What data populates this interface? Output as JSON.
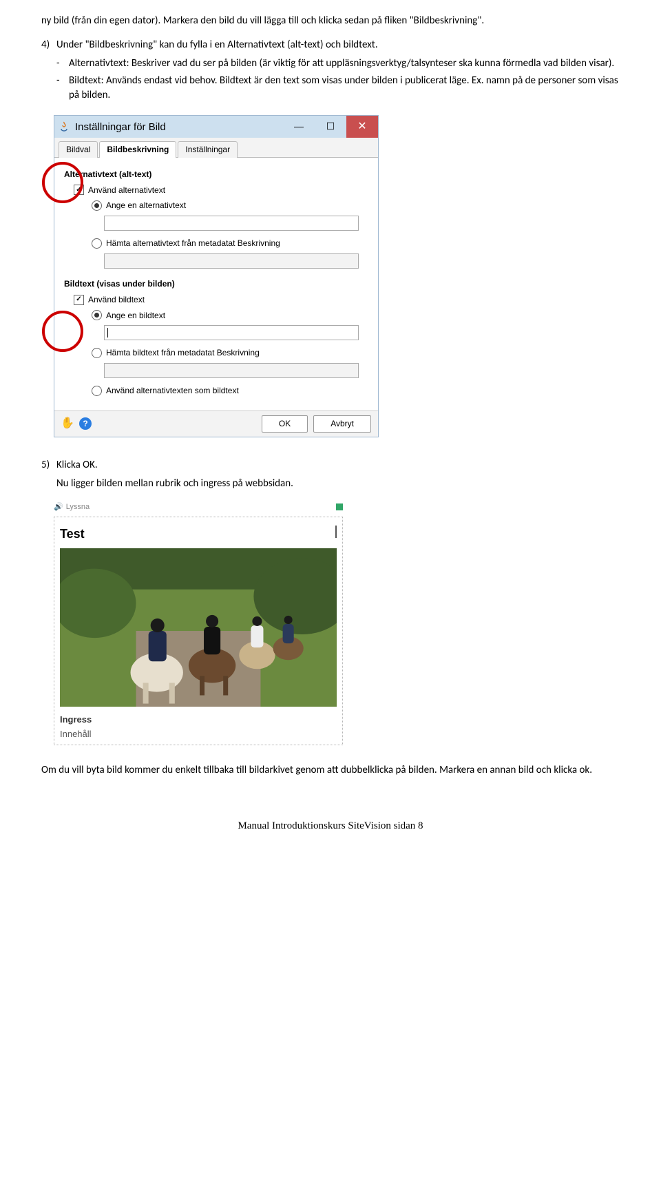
{
  "intro": {
    "p1": "ny bild (från din egen dator). Markera den bild du vill lägga till och klicka sedan på fliken \"Bildbeskrivning\"."
  },
  "step4": {
    "num": "4)",
    "text": "Under \"Bildbeskrivning\" kan du fylla i en Alternativtext (alt-text) och bildtext.",
    "dash1": "Alternativtext: Beskriver vad du ser på bilden (är viktig för att uppläsningsverktyg/talsynteser ska kunna förmedla vad bilden visar).",
    "dash2": "Bildtext: Används endast vid behov. Bildtext är den text som visas under bilden i publicerat läge. Ex. namn på de personer som visas på bilden."
  },
  "dialog": {
    "title": "Inställningar för Bild",
    "tabs": {
      "bildval": "Bildval",
      "bildbeskrivning": "Bildbeskrivning",
      "installningar": "Inställningar"
    },
    "alt": {
      "legend": "Alternativtext (alt-text)",
      "use": "Använd alternativtext",
      "opt_enter": "Ange en alternativtext",
      "opt_meta": "Hämta alternativtext från metadatat Beskrivning"
    },
    "bildtext": {
      "legend": "Bildtext (visas under bilden)",
      "use": "Använd bildtext",
      "opt_enter": "Ange en bildtext",
      "opt_meta": "Hämta bildtext från metadatat Beskrivning",
      "opt_alt": "Använd alternativtexten som bildtext"
    },
    "ok": "OK",
    "cancel": "Avbryt"
  },
  "step5": {
    "num": "5)",
    "text": "Klicka OK.",
    "after": "Nu ligger bilden mellan rubrik och ingress på webbsidan."
  },
  "preview": {
    "lyssna": "Lyssna",
    "title": "Test",
    "ingress": "Ingress",
    "innehall": "Innehåll"
  },
  "closing": {
    "p1": "Om du vill byta bild kommer du enkelt tillbaka till bildarkivet genom att dubbelklicka på bilden. Markera en annan bild och klicka ok."
  },
  "footer": "Manual Introduktionskurs SiteVision sidan 8"
}
